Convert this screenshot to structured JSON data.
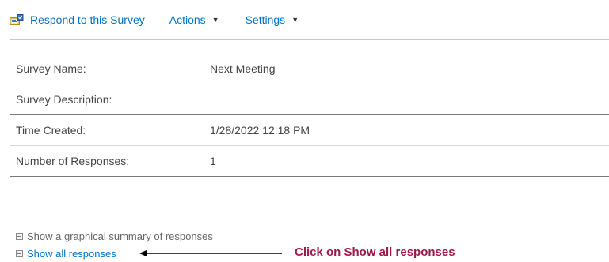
{
  "toolbar": {
    "respond_label": "Respond to this Survey",
    "actions_label": "Actions",
    "settings_label": "Settings",
    "accent_color": "#0072c6"
  },
  "properties": {
    "rows": [
      {
        "label": "Survey Name:",
        "value": "Next Meeting"
      },
      {
        "label": "Survey Description:",
        "value": ""
      },
      {
        "label": "Time Created:",
        "value": "1/28/2022 12:18 PM"
      },
      {
        "label": "Number of Responses:",
        "value": "1"
      }
    ]
  },
  "links": {
    "graphical_summary": "Show a graphical summary of responses",
    "show_all": "Show all responses"
  },
  "annotation": {
    "text": "Click on Show all responses",
    "color": "#9b1a49"
  },
  "icons": [
    "respond-survey-icon",
    "caret-down-icon",
    "expand-box-icon",
    "left-arrow-icon"
  ]
}
